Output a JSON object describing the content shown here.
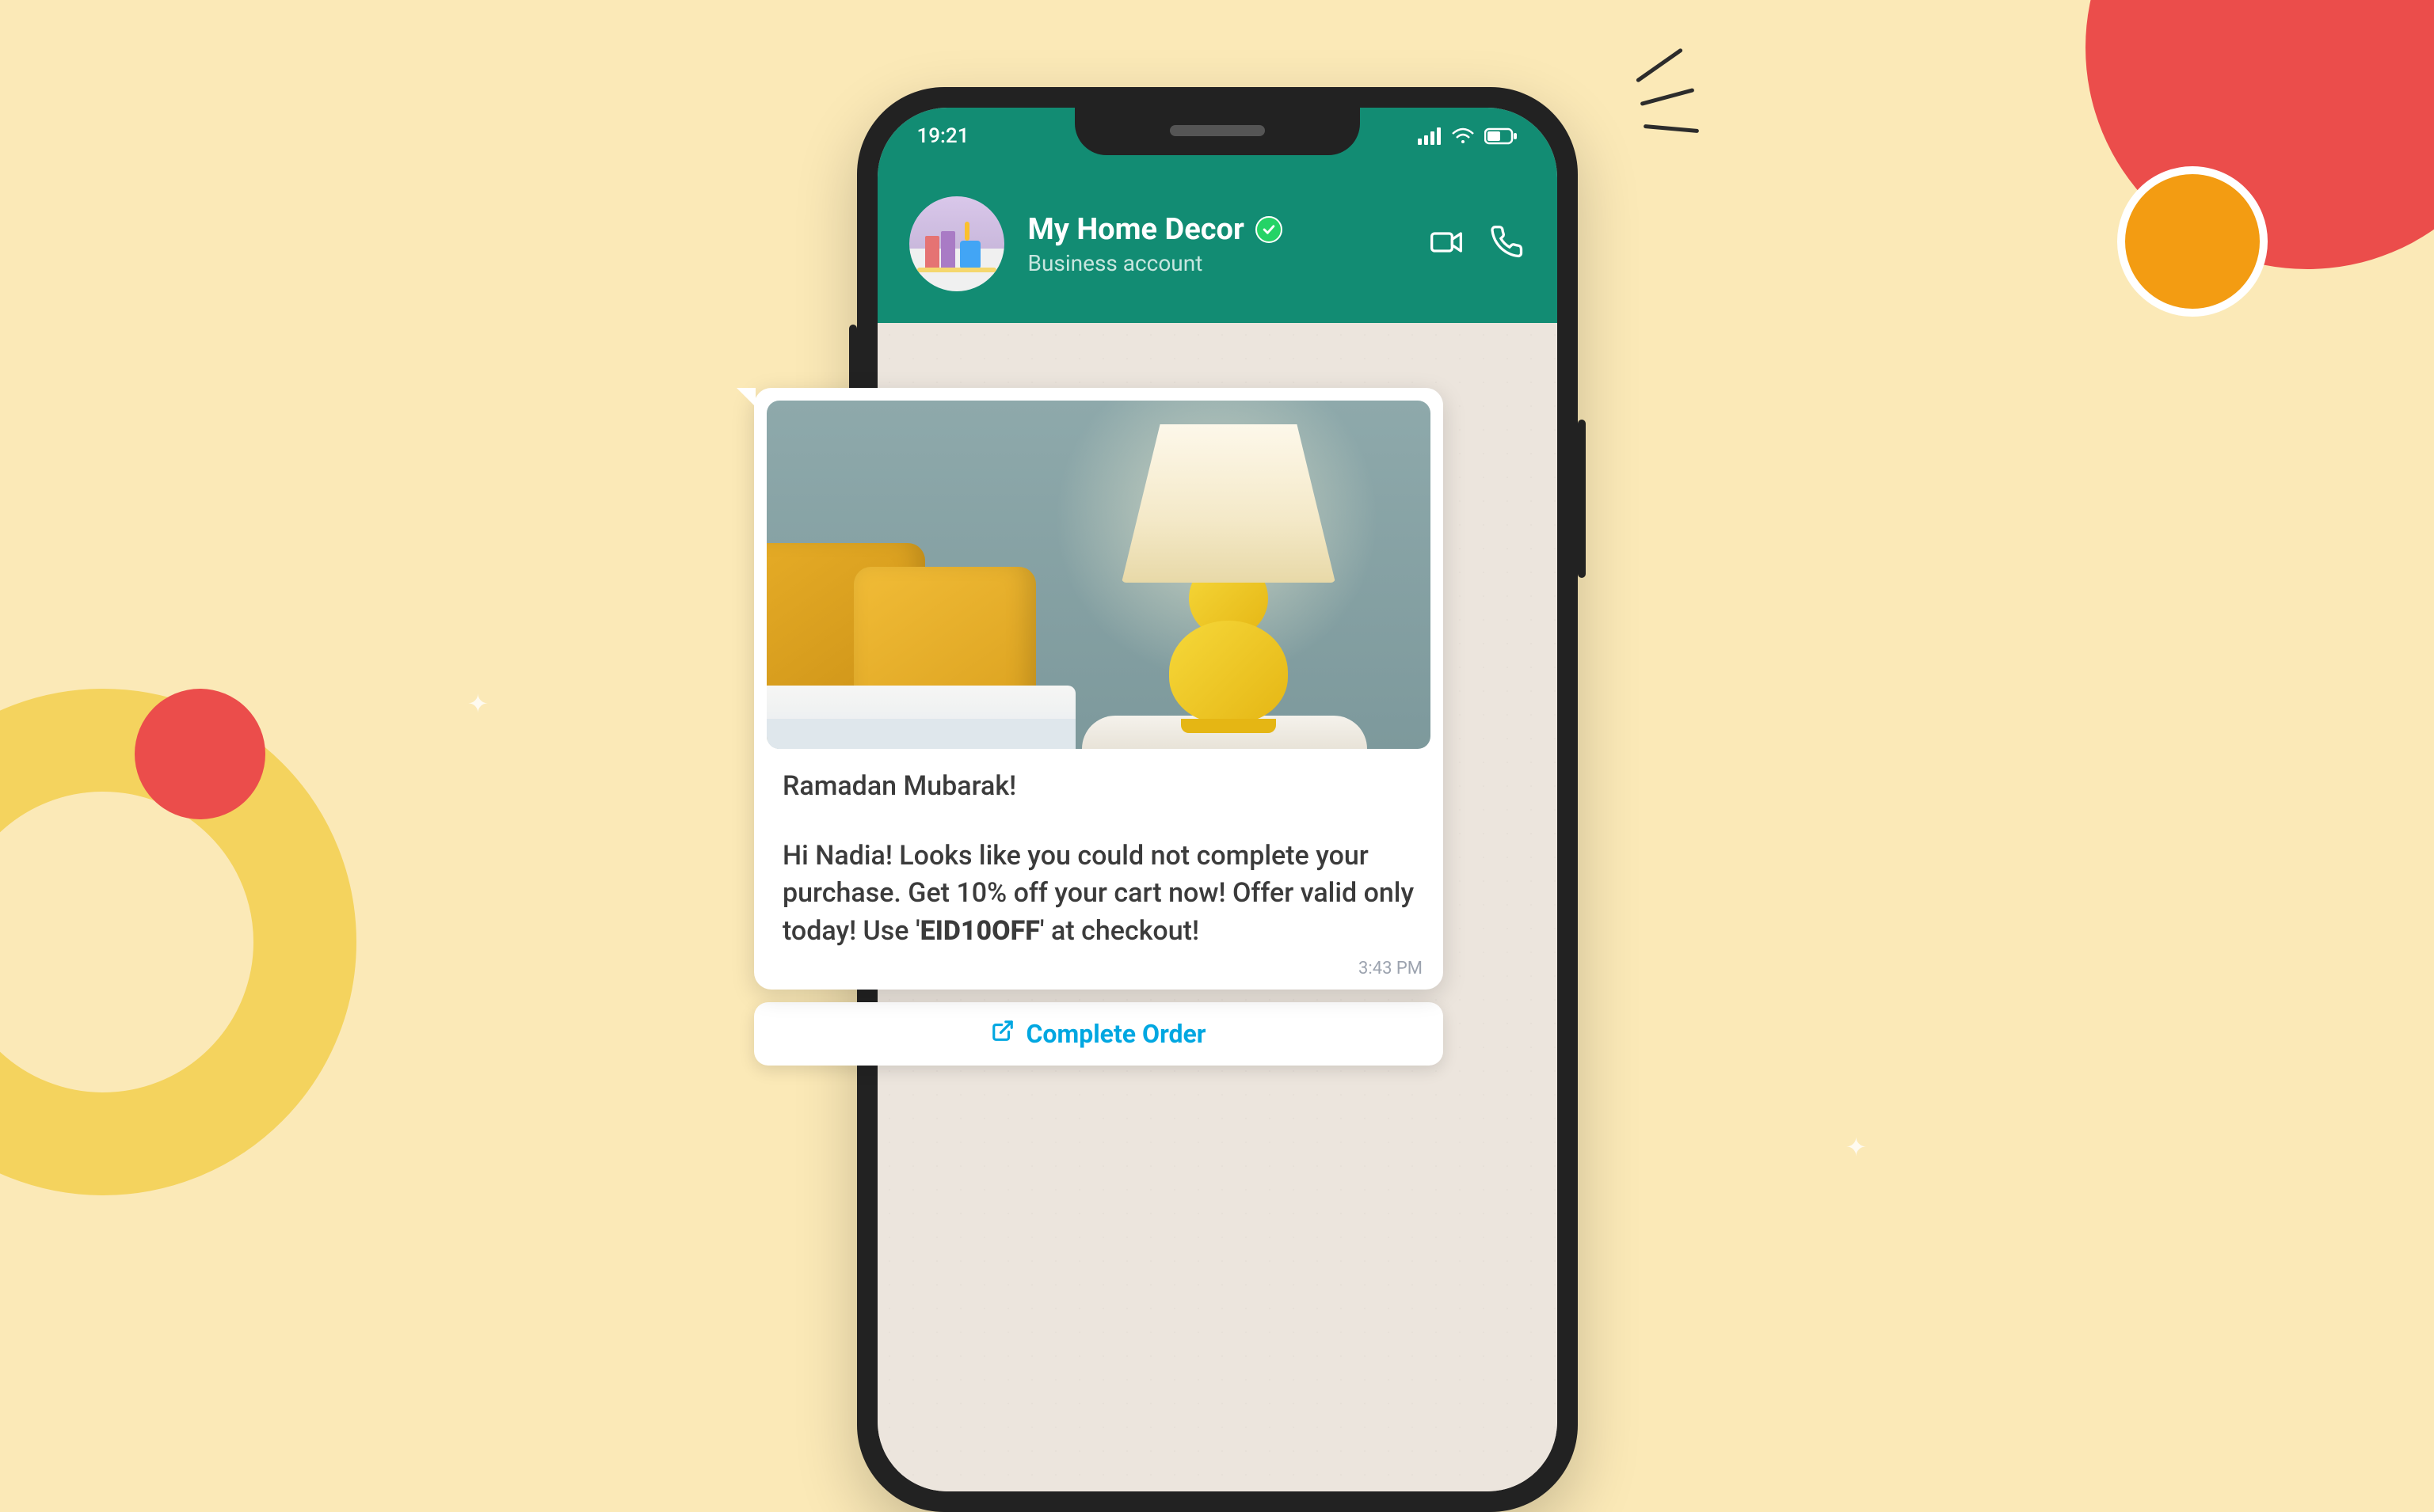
{
  "status_bar": {
    "time": "19:21"
  },
  "chat_header": {
    "title": "My Home Decor",
    "subtitle": "Business account"
  },
  "message": {
    "greeting": "Ramadan Mubarak!",
    "body_prefix": "Hi Nadia! Looks like you could not complete your purchase. Get 10% off your cart now! Offer valid only today! Use '",
    "promo_code": "EID10OFF",
    "body_suffix": "' at checkout!",
    "timestamp": "3:43 PM",
    "cta_label": "Complete Order"
  }
}
